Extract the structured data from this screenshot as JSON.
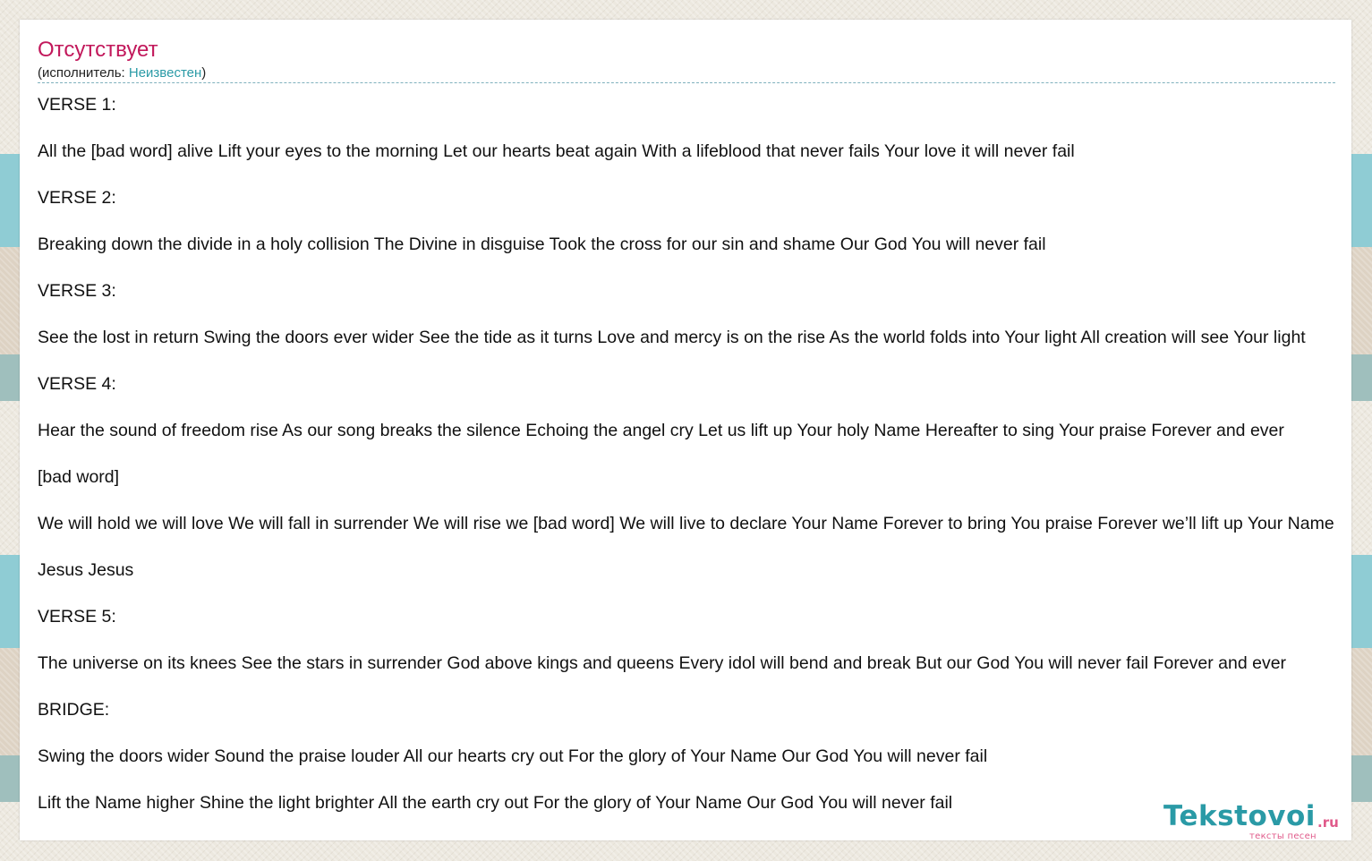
{
  "song": {
    "title": "Отсутствует",
    "performer_prefix": "(исполнитель: ",
    "performer_name": "Неизвестен",
    "performer_suffix": ")"
  },
  "lyrics": [
    "VERSE 1:",
    "All the [bad word] alive Lift your eyes to the morning Let our hearts beat again With a lifeblood that never fails Your love it will never fail",
    "VERSE 2:",
    "Breaking down the divide in a holy collision The Divine in disguise Took the cross for our sin and shame Our God You will never fail",
    "VERSE 3:",
    "See the lost in return Swing the doors ever wider See the tide as it turns Love and mercy is on the rise As the world folds into Your light All creation will see Your light",
    "VERSE 4:",
    "Hear the sound of freedom rise As our song breaks the silence Echoing the angel cry Let us lift up Your holy Name Hereafter to sing Your praise Forever and ever",
    " [bad word]",
    "We will hold we will love We will fall in surrender We will rise we [bad word] We will live to declare Your Name Forever to bring You praise Forever we’ll lift up Your Name",
    "Jesus Jesus",
    "VERSE 5:",
    "The universe on its knees See the stars in surrender God above kings and queens Every idol will bend and break But our God You will never fail Forever and ever",
    "BRIDGE:",
    "Swing the doors wider Sound the praise louder All our hearts cry out For the glory of Your Name Our God You will never fail",
    "Lift the Name higher Shine the light brighter All the earth cry out For the glory of Your Name Our God You will never fail"
  ],
  "logo": {
    "name": "Tekstovoi",
    "tld": ".ru",
    "tagline": "тексты песен"
  },
  "colors": {
    "title": "#c2185b",
    "link": "#2a9aa6",
    "logo_main": "#2a9aa6",
    "logo_accent": "#e05a8a",
    "stripe_teal": "#8fccd4",
    "stripe_beige": "#ddd2c3",
    "stripe_gray": "#9fbfbd"
  }
}
